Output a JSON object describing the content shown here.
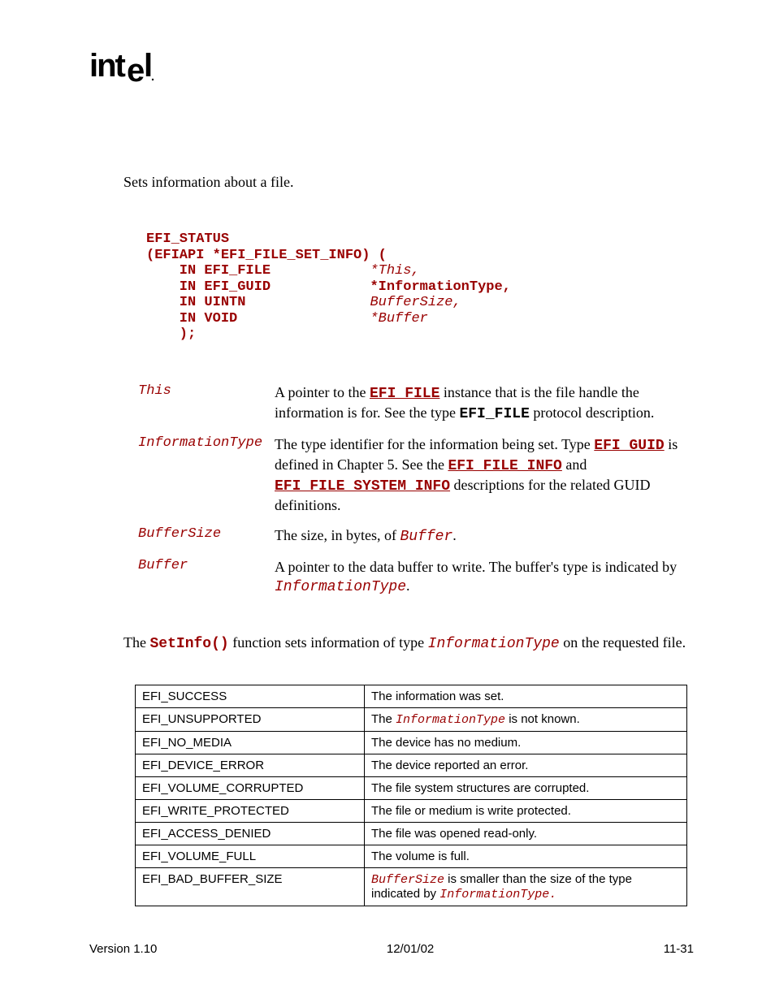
{
  "logo": "intel",
  "intro": "Sets information about a file.",
  "code": {
    "l1": "EFI_STATUS",
    "l2": "(EFIAPI *EFI_FILE_SET_INFO) (",
    "l3a": "    IN EFI_FILE            ",
    "l3b": "*This,",
    "l4a": "    IN EFI_GUID            ",
    "l4b": "*InformationType,",
    "l5a": "    IN UINTN               ",
    "l5b": "BufferSize,",
    "l6a": "    IN VOID                ",
    "l6b": "*Buffer",
    "l7": "    );"
  },
  "params": {
    "this": {
      "name": "This",
      "d1": "A pointer to the ",
      "d2": "EFI_FILE",
      "d3": " instance that is the file handle the information is for.  See the type ",
      "d4": "EFI_FILE",
      "d5": " protocol description."
    },
    "infotype": {
      "name": "InformationType",
      "d1": "The type identifier for the information being set.  Type ",
      "d2": "EFI_GUID",
      "d3": " is defined in Chapter 5.  See the ",
      "d4": "EFI_FILE_INFO",
      "d5": " and ",
      "d6": "EFI_FILE_SYSTEM_INFO",
      "d7": " descriptions for the related GUID definitions."
    },
    "bufsize": {
      "name": "BufferSize",
      "d1": "The size, in bytes, of ",
      "d2": "Buffer",
      "d3": "."
    },
    "buffer": {
      "name": "Buffer",
      "d1": "A pointer to the data buffer to write.  The buffer's type is indicated by ",
      "d2": "InformationType",
      "d3": "."
    }
  },
  "desc": {
    "p1": "The ",
    "p2": "SetInfo()",
    "p3": " function sets information of type ",
    "p4": "InformationType",
    "p5": " on the requested file."
  },
  "status": {
    "r1": {
      "code": "EFI_SUCCESS",
      "text": "The information was set."
    },
    "r2": {
      "code": "EFI_UNSUPPORTED",
      "t1": "The ",
      "t2": "InformationType",
      "t3": " is not known."
    },
    "r3": {
      "code": "EFI_NO_MEDIA",
      "text": "The device has no medium."
    },
    "r4": {
      "code": "EFI_DEVICE_ERROR",
      "text": "The device reported an error."
    },
    "r5": {
      "code": "EFI_VOLUME_CORRUPTED",
      "text": "The file system structures are corrupted."
    },
    "r6": {
      "code": "EFI_WRITE_PROTECTED",
      "text": "The file or medium is write protected."
    },
    "r7": {
      "code": "EFI_ACCESS_DENIED",
      "text": "The file was opened read-only."
    },
    "r8": {
      "code": "EFI_VOLUME_FULL",
      "text": "The volume is full."
    },
    "r9": {
      "code": "EFI_BAD_BUFFER_SIZE",
      "t1": "BufferSize",
      "t2": " is smaller than the size of the type indicated by ",
      "t3": "InformationType."
    }
  },
  "footer": {
    "left": "Version 1.10",
    "center": "12/01/02",
    "right": "11-31"
  }
}
